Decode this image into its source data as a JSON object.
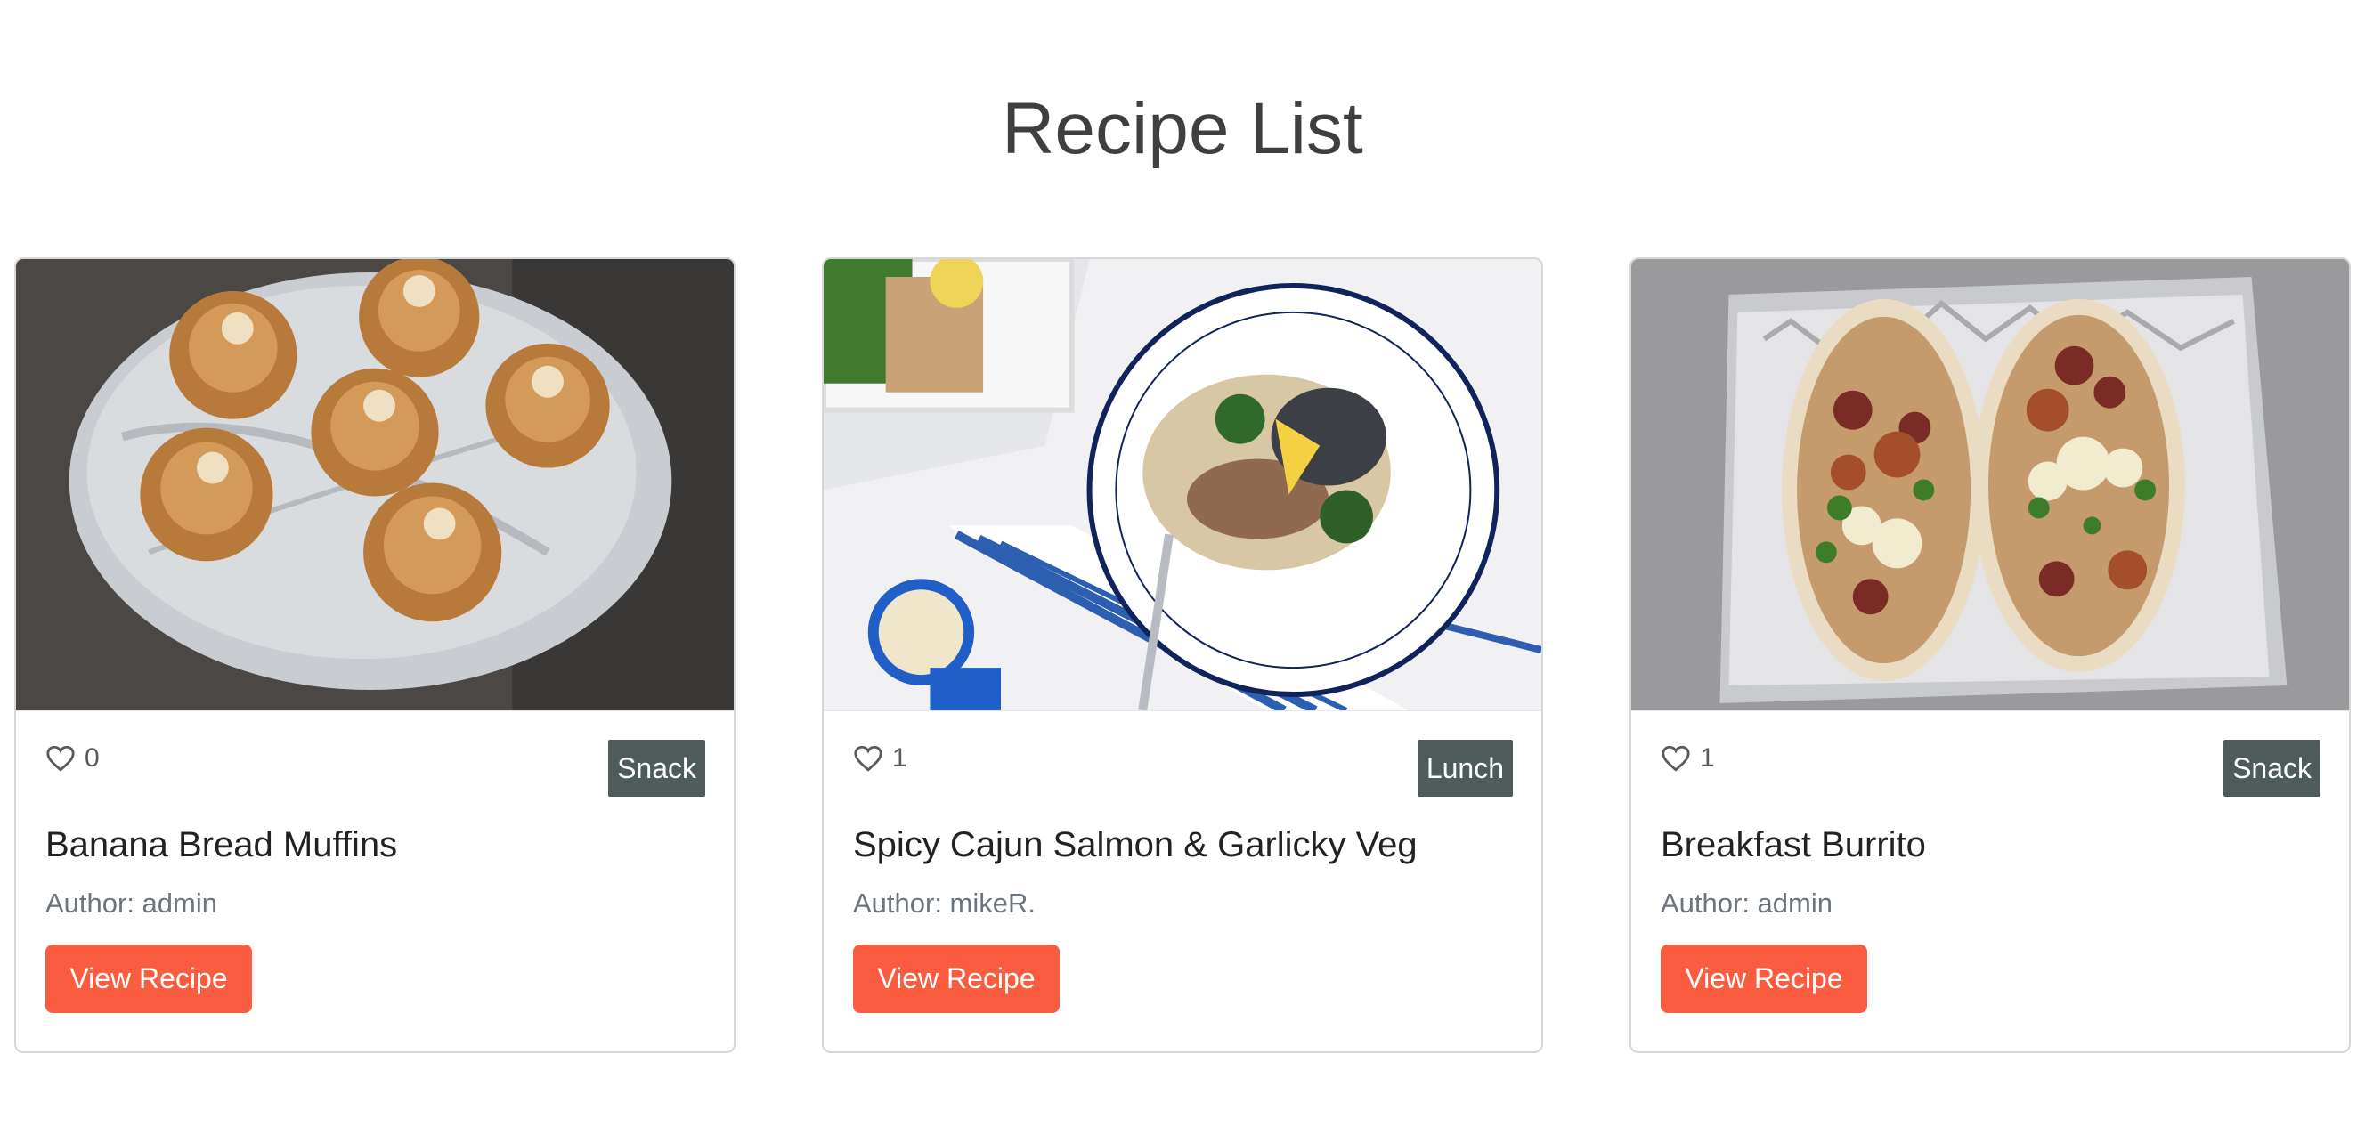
{
  "page": {
    "title": "Recipe List"
  },
  "recipes": [
    {
      "image_alt": "Banana Bread Muffins photo",
      "likes": "0",
      "category": "Snack",
      "title": "Banana Bread Muffins",
      "author": "Author: admin",
      "button": "View Recipe"
    },
    {
      "image_alt": "Spicy Cajun Salmon photo",
      "likes": "1",
      "category": "Lunch",
      "title": "Spicy Cajun Salmon & Garlicky Veg",
      "author": "Author: mikeR.",
      "button": "View Recipe"
    },
    {
      "image_alt": "Breakfast Burrito photo",
      "likes": "1",
      "category": "Snack",
      "title": "Breakfast Burrito",
      "author": "Author: admin",
      "button": "View Recipe"
    }
  ],
  "colors": {
    "accent": "#fa5c3f",
    "badge": "#4f5b5b",
    "title": "#3f3f3f",
    "muted": "#6c757d"
  },
  "icons": {
    "like": "heart-outline-icon"
  }
}
